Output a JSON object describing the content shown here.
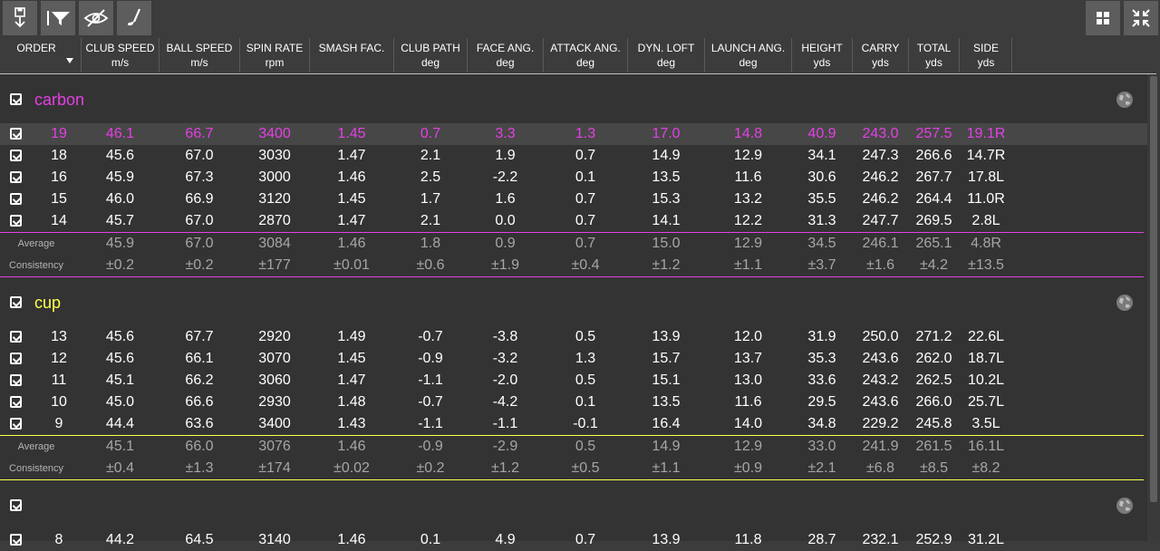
{
  "colors": {
    "carbon": "#e53fe5",
    "cup": "#ffff4d",
    "background": "#333333",
    "header": "#3c3c3c"
  },
  "toolbar": {
    "left_buttons": [
      "save-export-icon",
      "filter-icon",
      "hide-icon",
      "club-icon"
    ],
    "right_buttons": [
      "grid-view-icon",
      "compress-icon"
    ]
  },
  "columns": [
    {
      "key": "order",
      "label": "ORDER",
      "unit": ""
    },
    {
      "key": "club_speed",
      "label": "CLUB SPEED",
      "unit": "m/s"
    },
    {
      "key": "ball_speed",
      "label": "BALL SPEED",
      "unit": "m/s"
    },
    {
      "key": "spin_rate",
      "label": "SPIN RATE",
      "unit": "rpm"
    },
    {
      "key": "smash",
      "label": "SMASH FAC.",
      "unit": ""
    },
    {
      "key": "club_path",
      "label": "CLUB PATH",
      "unit": "deg"
    },
    {
      "key": "face_ang",
      "label": "FACE ANG.",
      "unit": "deg"
    },
    {
      "key": "attack_ang",
      "label": "ATTACK ANG.",
      "unit": "deg"
    },
    {
      "key": "dyn_loft",
      "label": "DYN. LOFT",
      "unit": "deg"
    },
    {
      "key": "launch_ang",
      "label": "LAUNCH ANG.",
      "unit": "deg"
    },
    {
      "key": "height",
      "label": "HEIGHT",
      "unit": "yds"
    },
    {
      "key": "carry",
      "label": "CARRY",
      "unit": "yds"
    },
    {
      "key": "total",
      "label": "TOTAL",
      "unit": "yds"
    },
    {
      "key": "side",
      "label": "SIDE",
      "unit": "yds"
    }
  ],
  "groups": [
    {
      "name": "carbon",
      "rows": [
        [
          "19",
          "46.1",
          "66.7",
          "3400",
          "1.45",
          "0.7",
          "3.3",
          "1.3",
          "17.0",
          "14.8",
          "40.9",
          "243.0",
          "257.5",
          "19.1R"
        ],
        [
          "18",
          "45.6",
          "67.0",
          "3030",
          "1.47",
          "2.1",
          "1.9",
          "0.7",
          "14.9",
          "12.9",
          "34.1",
          "247.3",
          "266.6",
          "14.7R"
        ],
        [
          "16",
          "45.9",
          "67.3",
          "3000",
          "1.46",
          "2.5",
          "-2.2",
          "0.1",
          "13.5",
          "11.6",
          "30.6",
          "246.2",
          "267.7",
          "17.8L"
        ],
        [
          "15",
          "46.0",
          "66.9",
          "3120",
          "1.45",
          "1.7",
          "1.6",
          "0.7",
          "15.3",
          "13.2",
          "35.5",
          "246.2",
          "264.4",
          "11.0R"
        ],
        [
          "14",
          "45.7",
          "67.0",
          "2870",
          "1.47",
          "2.1",
          "0.0",
          "0.7",
          "14.1",
          "12.2",
          "31.3",
          "247.7",
          "269.5",
          "2.8L"
        ]
      ],
      "average_label": "Average",
      "average": [
        "45.9",
        "67.0",
        "3084",
        "1.46",
        "1.8",
        "0.9",
        "0.7",
        "15.0",
        "12.9",
        "34.5",
        "246.1",
        "265.1",
        "4.8R"
      ],
      "consistency_label": "Consistency",
      "consistency": [
        "±0.2",
        "±0.2",
        "±177",
        "±0.01",
        "±0.6",
        "±1.9",
        "±0.4",
        "±1.2",
        "±1.1",
        "±3.7",
        "±1.6",
        "±4.2",
        "±13.5"
      ]
    },
    {
      "name": "cup",
      "rows": [
        [
          "13",
          "45.6",
          "67.7",
          "2920",
          "1.49",
          "-0.7",
          "-3.8",
          "0.5",
          "13.9",
          "12.0",
          "31.9",
          "250.0",
          "271.2",
          "22.6L"
        ],
        [
          "12",
          "45.6",
          "66.1",
          "3070",
          "1.45",
          "-0.9",
          "-3.2",
          "1.3",
          "15.7",
          "13.7",
          "35.3",
          "243.6",
          "262.0",
          "18.7L"
        ],
        [
          "11",
          "45.1",
          "66.2",
          "3060",
          "1.47",
          "-1.1",
          "-2.0",
          "0.5",
          "15.1",
          "13.0",
          "33.6",
          "243.2",
          "262.5",
          "10.2L"
        ],
        [
          "10",
          "45.0",
          "66.6",
          "2930",
          "1.48",
          "-0.7",
          "-4.2",
          "0.1",
          "13.5",
          "11.6",
          "29.5",
          "243.6",
          "266.0",
          "25.7L"
        ],
        [
          "9",
          "44.4",
          "63.6",
          "3400",
          "1.43",
          "-1.1",
          "-1.1",
          "-0.1",
          "16.4",
          "14.0",
          "34.8",
          "229.2",
          "245.8",
          "3.5L"
        ]
      ],
      "average_label": "Average",
      "average": [
        "45.1",
        "66.0",
        "3076",
        "1.46",
        "-0.9",
        "-2.9",
        "0.5",
        "14.9",
        "12.9",
        "33.0",
        "241.9",
        "261.5",
        "16.1L"
      ],
      "consistency_label": "Consistency",
      "consistency": [
        "±0.4",
        "±1.3",
        "±174",
        "±0.02",
        "±0.2",
        "±1.2",
        "±0.5",
        "±1.1",
        "±0.9",
        "±2.1",
        "±6.8",
        "±8.5",
        "±8.2"
      ]
    },
    {
      "name": "",
      "rows": [
        [
          "8",
          "44.2",
          "64.5",
          "3140",
          "1.46",
          "0.1",
          "4.9",
          "0.7",
          "13.9",
          "11.8",
          "28.7",
          "232.1",
          "252.9",
          "31.2L"
        ]
      ]
    }
  ],
  "selected_row": "19"
}
